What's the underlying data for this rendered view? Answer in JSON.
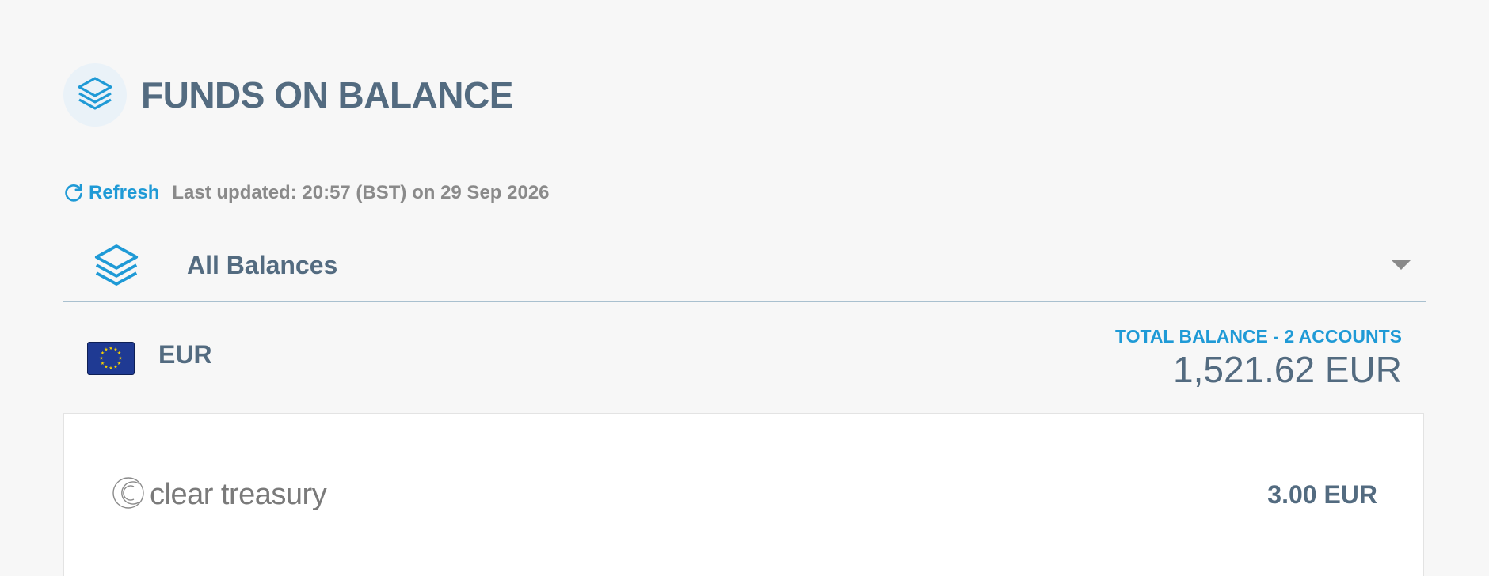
{
  "header": {
    "title": "FUNDS ON BALANCE",
    "icon": "layers-icon"
  },
  "refresh": {
    "label": "Refresh",
    "icon": "refresh-icon",
    "last_updated": "Last updated: 20:57 (BST) on 29 Sep 2026"
  },
  "balance_select": {
    "selected": "All Balances",
    "icon": "layers-icon"
  },
  "currency": {
    "code": "EUR",
    "flag": "eu-flag-icon",
    "total_label": "TOTAL BALANCE - 2 ACCOUNTS",
    "total_value": "1,521.62 EUR"
  },
  "accounts": [
    {
      "provider": "clear treasury",
      "amount": "3.00 EUR"
    }
  ],
  "colors": {
    "accent": "#1f9ad6",
    "text": "#536b80",
    "muted": "#8a8a8a",
    "background": "#f7f7f7"
  }
}
